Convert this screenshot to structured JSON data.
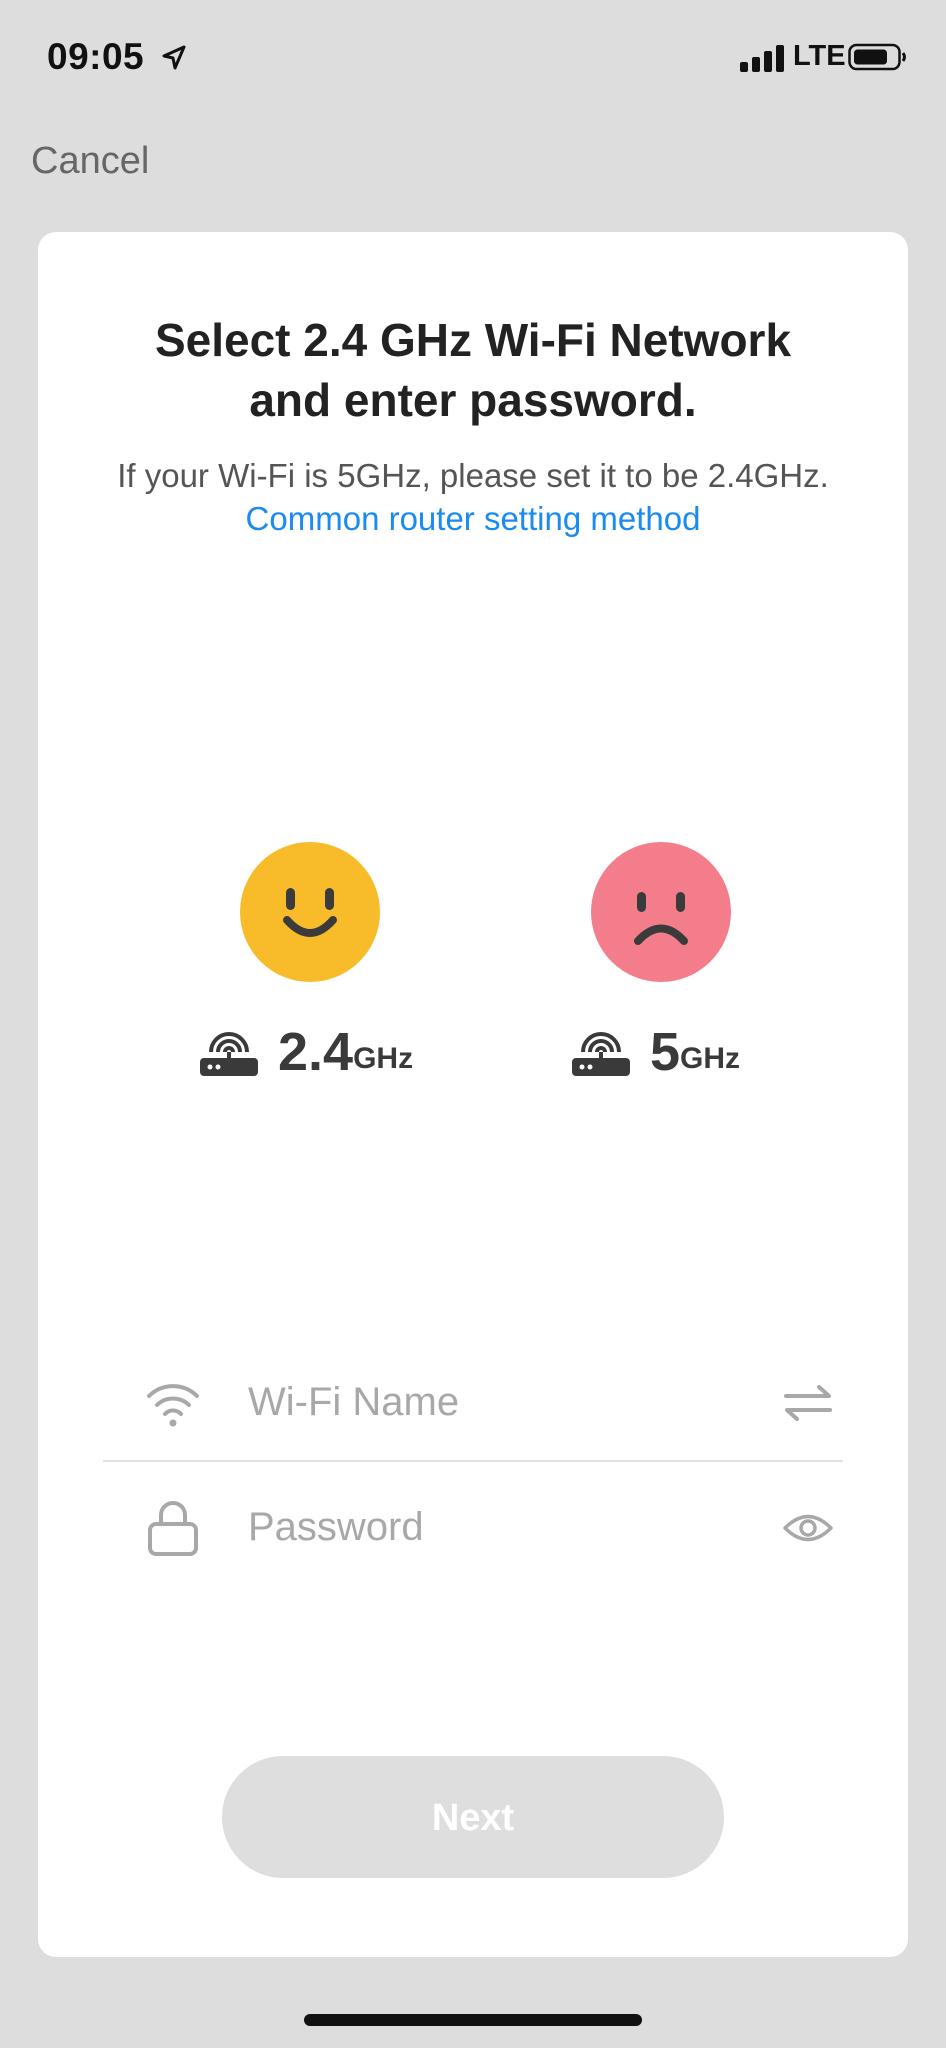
{
  "status_bar": {
    "time": "09:05",
    "network": "LTE",
    "icons": [
      "location-arrow-icon",
      "cellular-signal-icon",
      "battery-icon"
    ]
  },
  "nav": {
    "cancel_label": "Cancel"
  },
  "card": {
    "title": "Select 2.4 GHz Wi-Fi Network\nand enter password.",
    "subtitle_prefix": "If your Wi-Fi is 5GHz, please set it to be 2.4GHz. ",
    "subtitle_link": "Common router setting method",
    "link_color": "#1a8bf0"
  },
  "bands": [
    {
      "face": "happy-face-icon",
      "face_color": "#f8bb2a",
      "number": "2.4",
      "unit": "GHz"
    },
    {
      "face": "sad-face-icon",
      "face_color": "#f47d8c",
      "number": "5",
      "unit": "GHz"
    }
  ],
  "form": {
    "wifi_name": {
      "placeholder": "Wi-Fi Name",
      "value": "",
      "icon": "wifi-icon",
      "action_icon": "switch-network-icon"
    },
    "password": {
      "placeholder": "Password",
      "value": "",
      "icon": "lock-icon",
      "action_icon": "eye-icon"
    }
  },
  "actions": {
    "next_label": "Next"
  }
}
